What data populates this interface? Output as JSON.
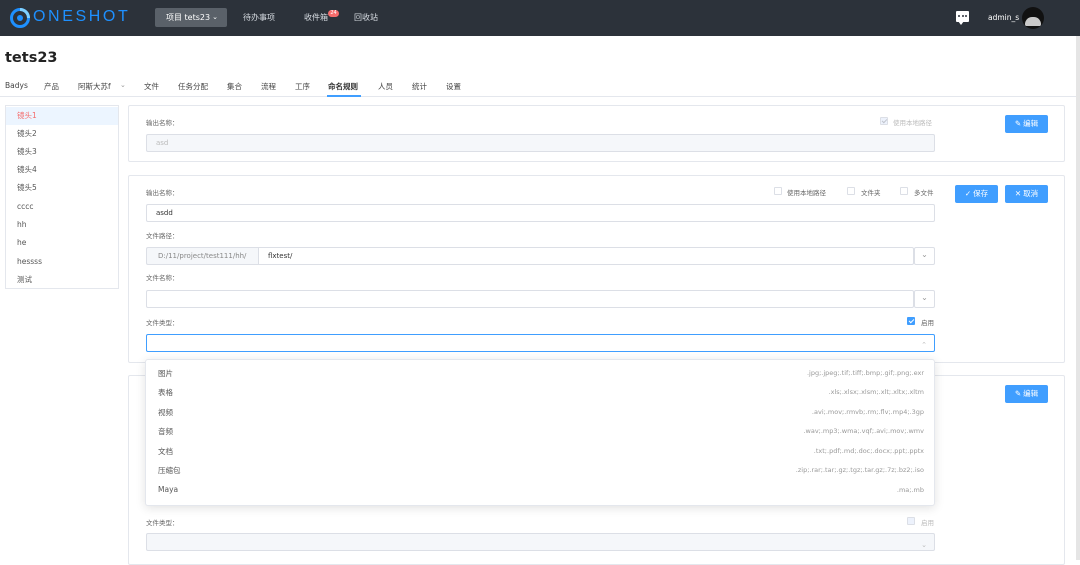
{
  "header": {
    "logo_text": "ONESHOT",
    "project_button": "项目 tets23",
    "nav": [
      "待办事项",
      "收件箱",
      "回收站"
    ],
    "inbox_badge": "24",
    "username": "admin_s"
  },
  "page": {
    "title": "tets23",
    "tabs": [
      "Badys",
      "产品",
      "阿斯大苏f",
      "文件",
      "任务分配",
      "集合",
      "流程",
      "工序",
      "命名规则",
      "人员",
      "统计",
      "设置"
    ],
    "active_tab": "命名规则"
  },
  "sidebar": {
    "items": [
      "镜头1",
      "镜头2",
      "镜头3",
      "镜头4",
      "镜头5",
      "cccc",
      "hh",
      "he",
      "hessss",
      "测试"
    ],
    "active_index": 0
  },
  "panel1": {
    "output_label": "输出名称：",
    "output_value": "asd",
    "use_local_path": "使用本地路径",
    "edit_button": "编辑"
  },
  "panel2": {
    "output_label": "输出名称：",
    "output_value": "asdd",
    "use_local_path": "使用本地路径",
    "folder": "文件夹",
    "multi_file": "多文件",
    "save_button": "保存",
    "cancel_button": "取消",
    "file_path_label": "文件路径：",
    "path_prefix": "D:/11/project/test111/hh/",
    "path_value": "flxtest/",
    "file_name_label": "文件名称：",
    "file_name_value": "",
    "file_type_label": "文件类型：",
    "enable_label": "启用",
    "enable_checked": true
  },
  "panel3": {
    "edit_button": "编辑",
    "file_type_label": "文件类型：",
    "enable_label": "启用"
  },
  "dropdown": {
    "options": [
      {
        "name": "图片",
        "ext": ".jpg;.jpeg;.tif;.tiff;.bmp;.gif;.png;.exr"
      },
      {
        "name": "表格",
        "ext": ".xls;.xlsx;.xlsm;.xlt;.xltx;.xltm"
      },
      {
        "name": "视频",
        "ext": ".avi;.mov;.rmvb;.rm;.flv;.mp4;.3gp"
      },
      {
        "name": "音频",
        "ext": ".wav;.mp3;.wma;.vqf;.avi;.mov;.wmv"
      },
      {
        "name": "文档",
        "ext": ".txt;.pdf;.md;.doc;.docx;.ppt;.pptx"
      },
      {
        "name": "压缩包",
        "ext": ".zip;.rar;.tar;.gz;.tgz;.tar.gz;.7z;.bz2;.iso"
      },
      {
        "name": "Maya",
        "ext": ".ma;.mb"
      }
    ]
  },
  "colors": {
    "topbar": "#2c323a",
    "primary": "#409eff",
    "accent_red": "#f56c6c"
  }
}
